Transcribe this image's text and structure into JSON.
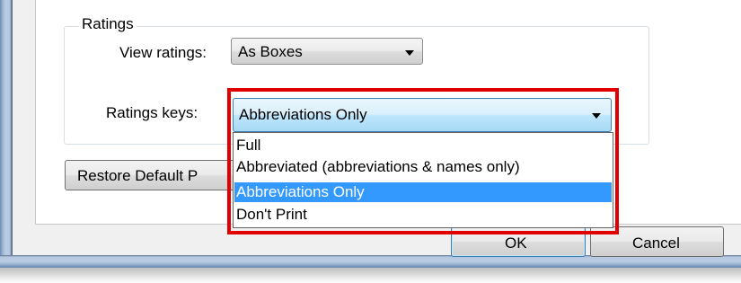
{
  "group": {
    "title": "Ratings"
  },
  "view_ratings": {
    "label": "View ratings:",
    "value": "As Boxes"
  },
  "ratings_keys": {
    "label": "Ratings keys:",
    "value": "Abbreviations Only",
    "options": [
      {
        "label": "Full",
        "selected": false
      },
      {
        "label": "Abbreviated (abbreviations & names only)",
        "selected": false
      },
      {
        "label": "Abbreviations Only",
        "selected": true
      },
      {
        "label": "Don't Print",
        "selected": false
      }
    ]
  },
  "buttons": {
    "restore_label": "Restore Default P",
    "ok_label": "OK",
    "cancel_label": "Cancel"
  },
  "colors": {
    "highlight": "#e00000",
    "selection": "#3399ff",
    "focus_border": "#3c7fb1"
  }
}
